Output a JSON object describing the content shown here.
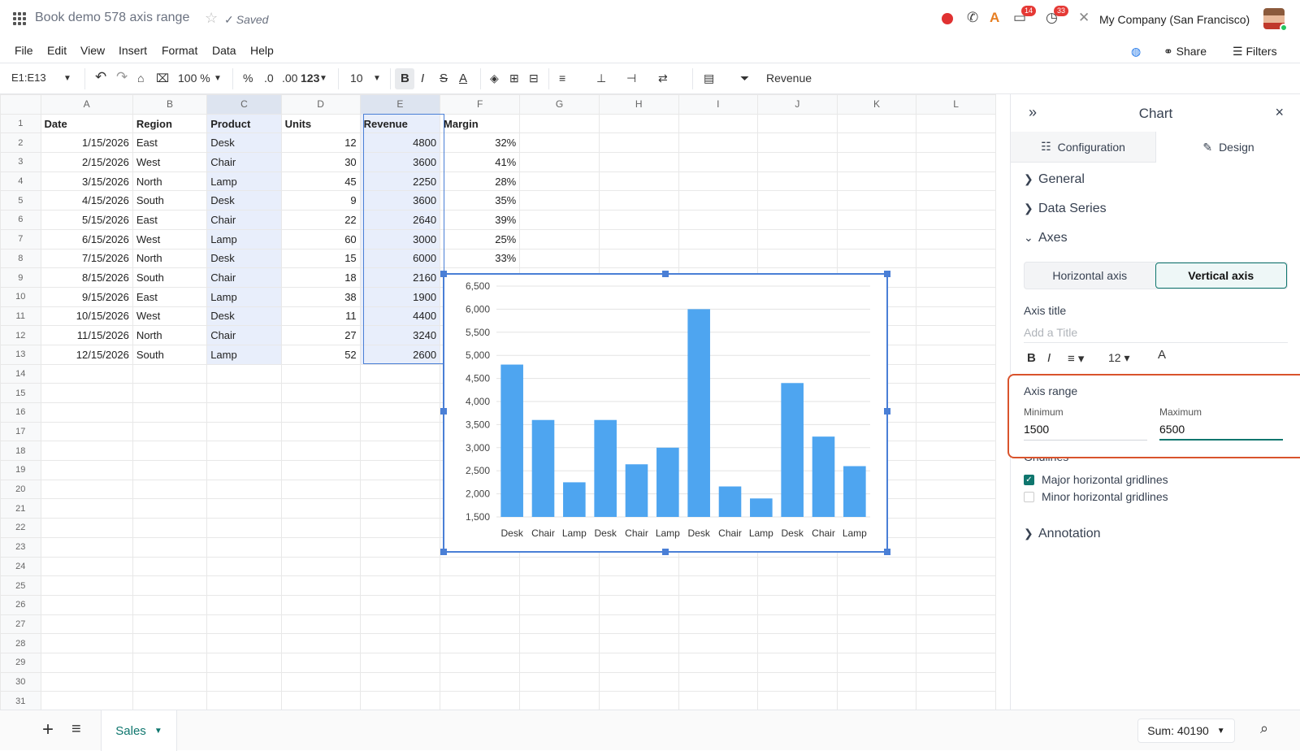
{
  "doc": {
    "title": "Book demo 578 axis range",
    "saved": "Saved"
  },
  "topbar": {
    "company": "My Company (San Francisco)",
    "badge_messages": "14",
    "badge_activity": "33"
  },
  "menu": {
    "items": [
      "File",
      "Edit",
      "View",
      "Insert",
      "Format",
      "Data",
      "Help"
    ],
    "share": "Share",
    "filters": "Filters"
  },
  "toolbar": {
    "cell_ref": "E1:E13",
    "zoom": "100 %",
    "percent": "%",
    "dec_less": ".0",
    "dec_more": ".00",
    "num_fmt": "123",
    "font_size": "10",
    "formula": "Revenue"
  },
  "sheet": {
    "columns": [
      "A",
      "B",
      "C",
      "D",
      "E",
      "F",
      "G",
      "H",
      "I",
      "J",
      "K",
      "L"
    ],
    "headers": [
      "Date",
      "Region",
      "Product",
      "Units",
      "Revenue",
      "Margin"
    ],
    "rows": [
      [
        "1/15/2026",
        "East",
        "Desk",
        "12",
        "4800",
        "32%"
      ],
      [
        "2/15/2026",
        "West",
        "Chair",
        "30",
        "3600",
        "41%"
      ],
      [
        "3/15/2026",
        "North",
        "Lamp",
        "45",
        "2250",
        "28%"
      ],
      [
        "4/15/2026",
        "South",
        "Desk",
        "9",
        "3600",
        "35%"
      ],
      [
        "5/15/2026",
        "East",
        "Chair",
        "22",
        "2640",
        "39%"
      ],
      [
        "6/15/2026",
        "West",
        "Lamp",
        "60",
        "3000",
        "25%"
      ],
      [
        "7/15/2026",
        "North",
        "Desk",
        "15",
        "6000",
        "33%"
      ],
      [
        "8/15/2026",
        "South",
        "Chair",
        "18",
        "2160",
        ""
      ],
      [
        "9/15/2026",
        "East",
        "Lamp",
        "38",
        "1900",
        ""
      ],
      [
        "10/15/2026",
        "West",
        "Desk",
        "11",
        "4400",
        ""
      ],
      [
        "11/15/2026",
        "North",
        "Chair",
        "27",
        "3240",
        ""
      ],
      [
        "12/15/2026",
        "South",
        "Lamp",
        "52",
        "2600",
        ""
      ]
    ],
    "tab_name": "Sales",
    "sum_label": "Sum: 40190"
  },
  "chart_data": {
    "type": "bar",
    "categories": [
      "Desk",
      "Chair",
      "Lamp",
      "Desk",
      "Chair",
      "Lamp",
      "Desk",
      "Chair",
      "Lamp",
      "Desk",
      "Chair",
      "Lamp"
    ],
    "values": [
      4800,
      3600,
      2250,
      3600,
      2640,
      3000,
      6000,
      2160,
      1900,
      4400,
      3240,
      2600
    ],
    "ylim": [
      1500,
      6500
    ],
    "yticks": [
      "1,500",
      "2,000",
      "2,500",
      "3,000",
      "3,500",
      "4,000",
      "4,500",
      "5,000",
      "5,500",
      "6,000",
      "6,500"
    ],
    "ytick_values": [
      1500,
      2000,
      2500,
      3000,
      3500,
      4000,
      4500,
      5000,
      5500,
      6000,
      6500
    ],
    "grid": true,
    "bar_color": "#4ea5f0",
    "title": "",
    "xlabel": "",
    "ylabel": ""
  },
  "panel": {
    "title": "Chart",
    "tab_config": "Configuration",
    "tab_design": "Design",
    "sec_general": "General",
    "sec_series": "Data Series",
    "sec_axes": "Axes",
    "axis_h": "Horizontal axis",
    "axis_v": "Vertical axis",
    "axis_title_label": "Axis title",
    "axis_title_placeholder": "Add a Title",
    "title_font_size": "12",
    "range_label": "Axis range",
    "min_label": "Minimum",
    "min_value": "1500",
    "max_label": "Maximum",
    "max_value": "6500",
    "gridlines_label": "Gridlines",
    "major_grid": "Major horizontal gridlines",
    "minor_grid": "Minor horizontal gridlines",
    "sec_annotation": "Annotation"
  },
  "colors": {
    "accent": "#0f766e",
    "selection": "#4a7fd6",
    "highlight": "#d9532c"
  }
}
